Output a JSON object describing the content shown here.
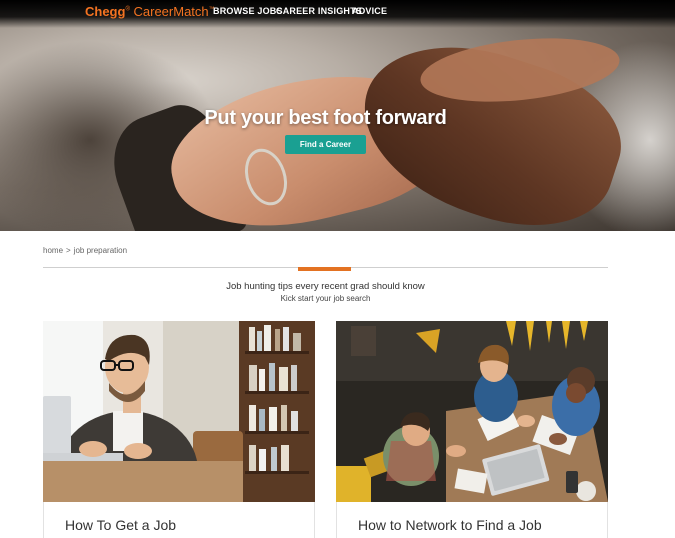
{
  "brand": {
    "logo_bold": "Chegg",
    "logo_rest": "CareerMatch",
    "trademark": "™",
    "color": "#f47321"
  },
  "nav": {
    "items": [
      {
        "label": "BROWSE JOBS"
      },
      {
        "label": "CAREER INSIGHTS"
      },
      {
        "label": "ADVICE"
      }
    ]
  },
  "hero": {
    "title": "Put your best foot forward",
    "cta_label": "Find a Career",
    "cta_color": "#1aa092"
  },
  "breadcrumb": {
    "home": "home",
    "separator": ">",
    "current": "job preparation"
  },
  "section": {
    "title": "Job hunting tips every recent grad should know",
    "subtitle": "Kick start your job search",
    "accent_color": "#e37222"
  },
  "cards": [
    {
      "title": "How To Get a Job"
    },
    {
      "title": "How to Network to Find a Job"
    }
  ]
}
